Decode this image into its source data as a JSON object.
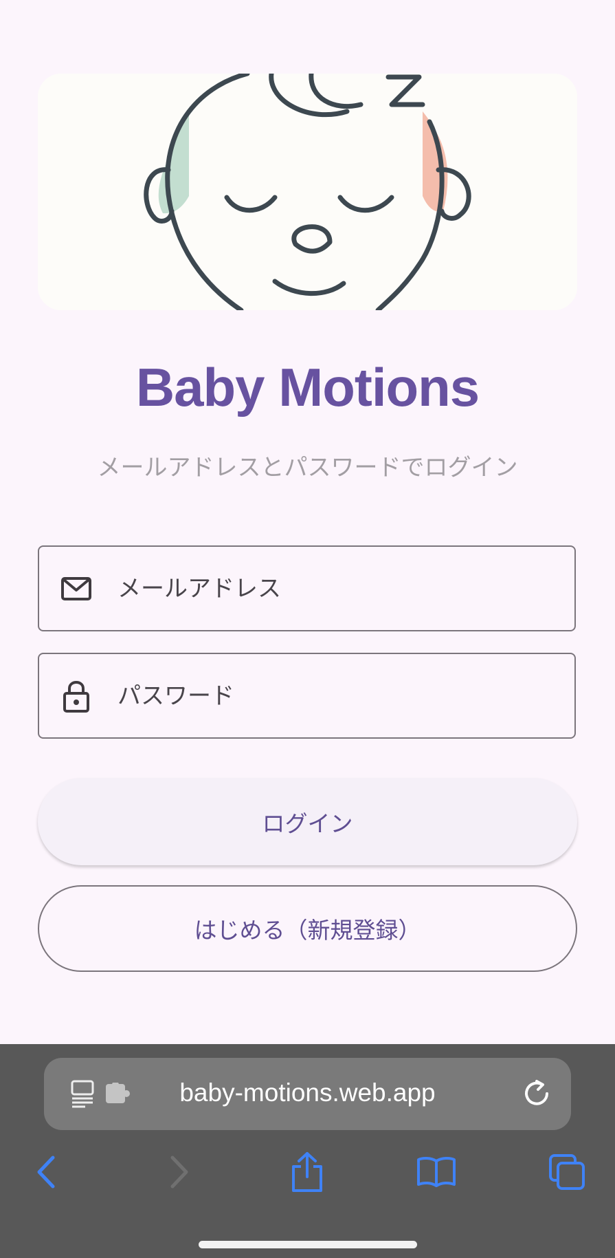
{
  "app": {
    "title": "Baby Motions",
    "subtitle": "メールアドレスとパスワードでログイン"
  },
  "form": {
    "email_placeholder": "メールアドレス",
    "password_placeholder": "パスワード",
    "email_icon": "envelope-icon",
    "password_icon": "lock-icon"
  },
  "buttons": {
    "login_label": "ログイン",
    "signup_label": "はじめる（新規登録）"
  },
  "browser": {
    "url": "baby-motions.web.app",
    "icons": [
      "page-menu-icon",
      "extension-icon",
      "reload-icon",
      "back-icon",
      "forward-icon",
      "share-icon",
      "bookmarks-icon",
      "tabs-icon"
    ],
    "forward_enabled": false
  },
  "colors": {
    "brand": "#6752a0",
    "background": "#fcf5fc",
    "browser_accent": "#3f82f6"
  }
}
